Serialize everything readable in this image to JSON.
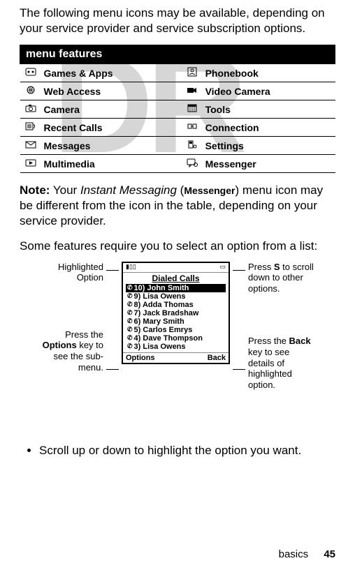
{
  "watermark": "DR",
  "intro_text": "The following menu icons may be available, depending on your service provider and service subscription options.",
  "table_header": "menu features",
  "features": {
    "r0c0": "Games & Apps",
    "r0c1": "Phonebook",
    "r1c0": "Web Access",
    "r1c1": "Video Camera",
    "r2c0": "Camera",
    "r2c1": "Tools",
    "r3c0": "Recent Calls",
    "r3c1": "Connection",
    "r4c0": "Messages",
    "r4c1": "Settings",
    "r5c0": "Multimedia",
    "r5c1": "Messenger"
  },
  "note": {
    "word": "Note:",
    "pre": " Your ",
    "im": "Instant Messaging",
    "mid1": " (",
    "mess": "Messenger",
    "mid2": ") menu icon may be different from the icon in the table, depending on your service provider."
  },
  "some_features_text": "Some features require you to select an option from a list:",
  "phone": {
    "title": "Dialed Calls",
    "items": [
      "10) John Smith",
      "9) Lisa Owens",
      "8) Adda Thomas",
      "7) Jack Bradshaw",
      "6) Mary Smith",
      "5) Carlos Emrys",
      "4) Dave Thompson",
      "3) Lisa Owens"
    ],
    "left_softkey": "Options",
    "right_softkey": "Back"
  },
  "labels": {
    "highlighted": "Highlighted Option",
    "options_key_pre": "Press the ",
    "options_key_bold": "Options",
    "options_key_post": " key to see the sub-menu.",
    "scroll_pre": "Press ",
    "scroll_sym": "S",
    "scroll_post": " to scroll down to other options.",
    "back_key_pre": "Press the ",
    "back_key_bold": "Back",
    "back_key_post": " key to see details of highlighted option."
  },
  "bullet": "Scroll up or down to highlight the option you want.",
  "footer_section": "basics",
  "footer_page": "45"
}
